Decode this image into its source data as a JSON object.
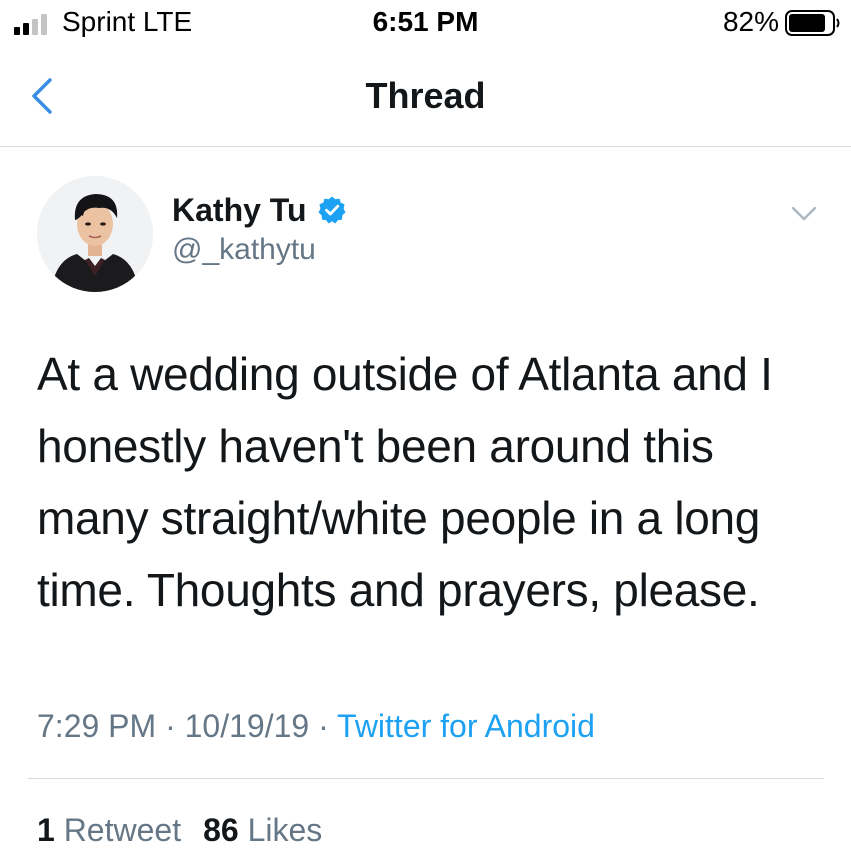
{
  "status_bar": {
    "carrier": "Sprint LTE",
    "time": "6:51 PM",
    "battery_percent": "82%",
    "signal_icon": "signal-bars-icon",
    "battery_icon": "battery-icon"
  },
  "nav": {
    "title": "Thread",
    "back_icon": "chevron-left-icon"
  },
  "tweet": {
    "author": {
      "name": "Kathy Tu",
      "handle": "@_kathytu",
      "verified": true
    },
    "text": "At a wedding outside of Atlanta and I\nhonestly haven't been around this\nmany straight/white people in a long\ntime. Thoughts and prayers, please.",
    "time": "7:29 PM",
    "date": "10/19/19",
    "source": "Twitter for Android",
    "separator": " · ",
    "stats": {
      "retweets_count": "1",
      "retweets_label": "Retweet",
      "likes_count": "86",
      "likes_label": "Likes"
    }
  },
  "colors": {
    "accent": "#1da1f2",
    "secondary_text": "#657786",
    "primary_text": "#14171a",
    "divider": "#d5d9dd",
    "ios_blue": "#3a8ee6"
  }
}
